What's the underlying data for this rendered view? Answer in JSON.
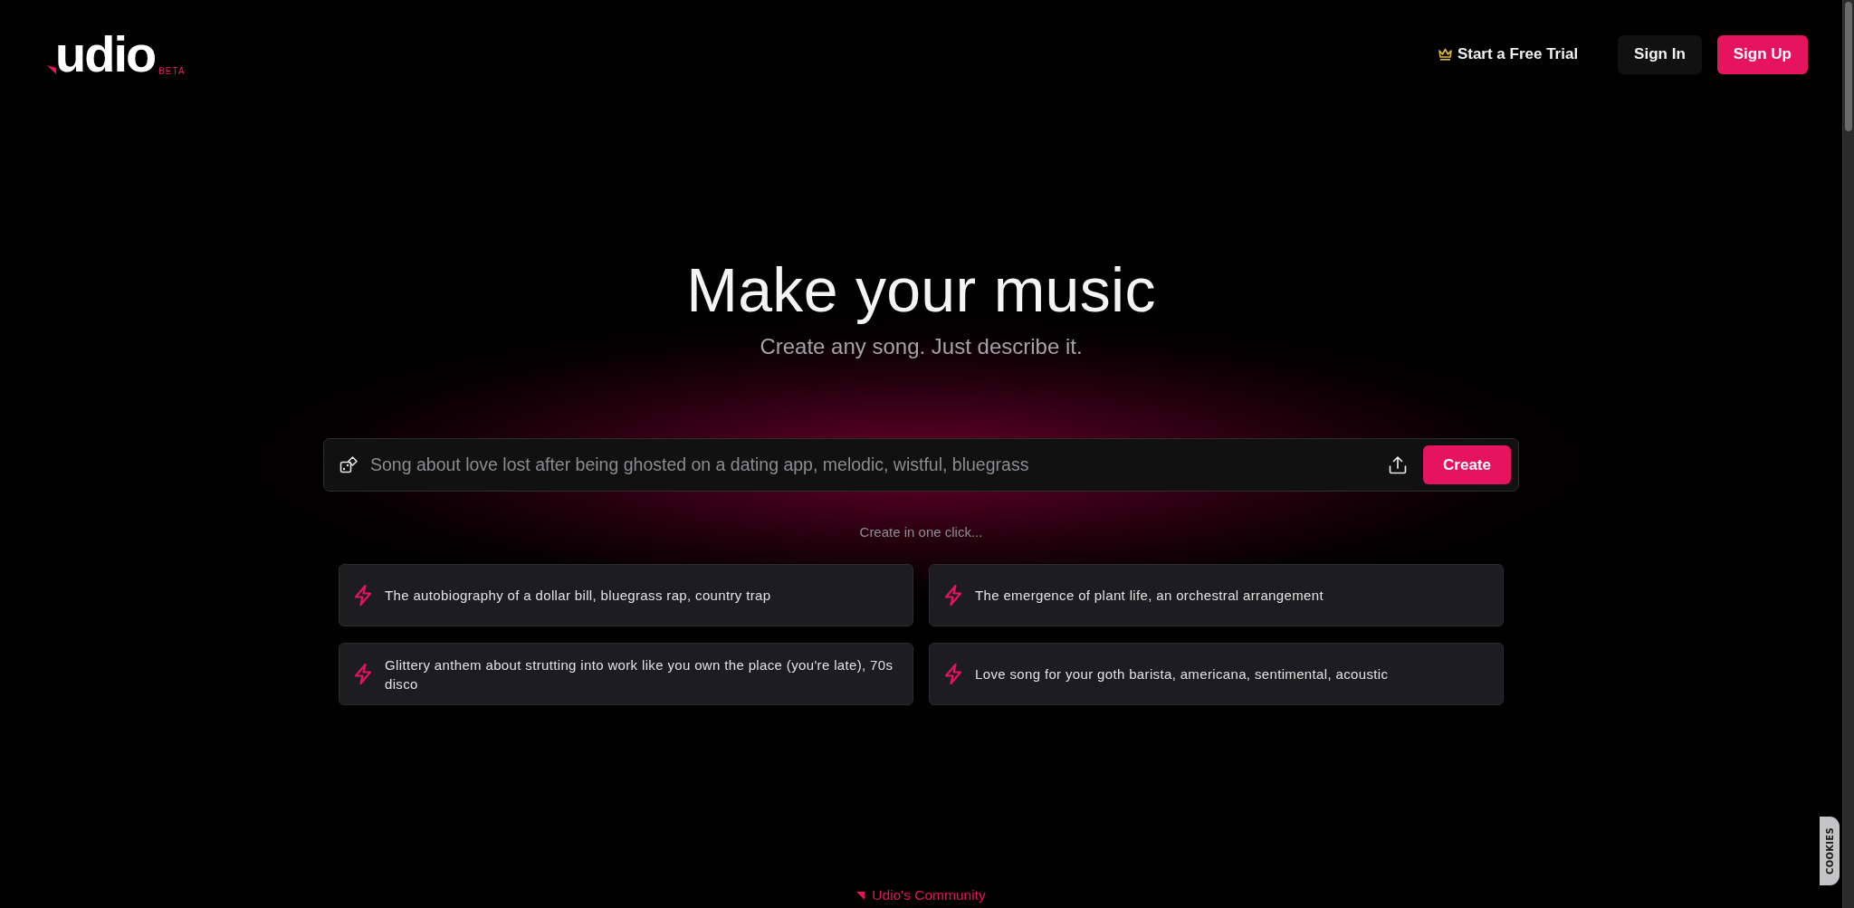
{
  "header": {
    "logo": {
      "wordmark": "udio",
      "badge": "BETA"
    },
    "trial_link": "Start a Free Trial",
    "buttons": [
      {
        "label": "Sign In",
        "kind": "secondary"
      },
      {
        "label": "Sign Up",
        "kind": "primary"
      }
    ]
  },
  "hero": {
    "title": "Make your music",
    "subtitle": "Create any song. Just describe it."
  },
  "prompt": {
    "placeholder": "Song about love lost after being ghosted on a dating app, melodic, wistful, bluegrass",
    "button": "Create"
  },
  "quick_create": {
    "label": "Create in one click...",
    "suggestions": [
      "The autobiography of a dollar bill, bluegrass rap, country trap",
      "The emergence of plant life, an orchestral arrangement",
      "Glittery anthem about strutting into work like you own the place (you're late), 70s disco",
      "Love song for your goth barista, americana, sentimental, acoustic"
    ]
  },
  "community_link": "Udio's Community",
  "cookies_tab": "COOKIES"
}
